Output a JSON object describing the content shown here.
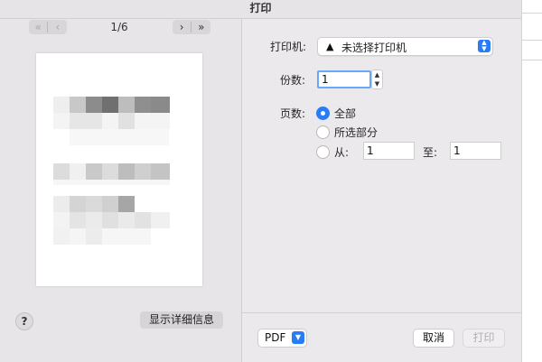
{
  "window": {
    "title": "打印"
  },
  "preview": {
    "page_indicator": "1/6",
    "first_icon": "«",
    "prev_icon": "‹",
    "next_icon": "›",
    "last_icon": "»",
    "help_label": "?",
    "details_label": "显示详细信息"
  },
  "form": {
    "printer_label": "打印机:",
    "printer_warning_icon": "warning-triangle",
    "printer_value": "未选择打印机",
    "copies_label": "份数:",
    "copies_value": "1",
    "pages_label": "页数:",
    "pages_options": {
      "all": "全部",
      "selection": "所选部分",
      "from": "从:"
    },
    "pages_selected": "全部",
    "from_value": "1",
    "to_label": "至:",
    "to_value": "1"
  },
  "footer": {
    "pdf_label": "PDF",
    "cancel_label": "取消",
    "print_label": "打印",
    "print_enabled": false
  },
  "colors": {
    "accent": "#2a7cf4",
    "dialog_bg": "#ece9ec",
    "disabled_text": "#b2afb2"
  }
}
